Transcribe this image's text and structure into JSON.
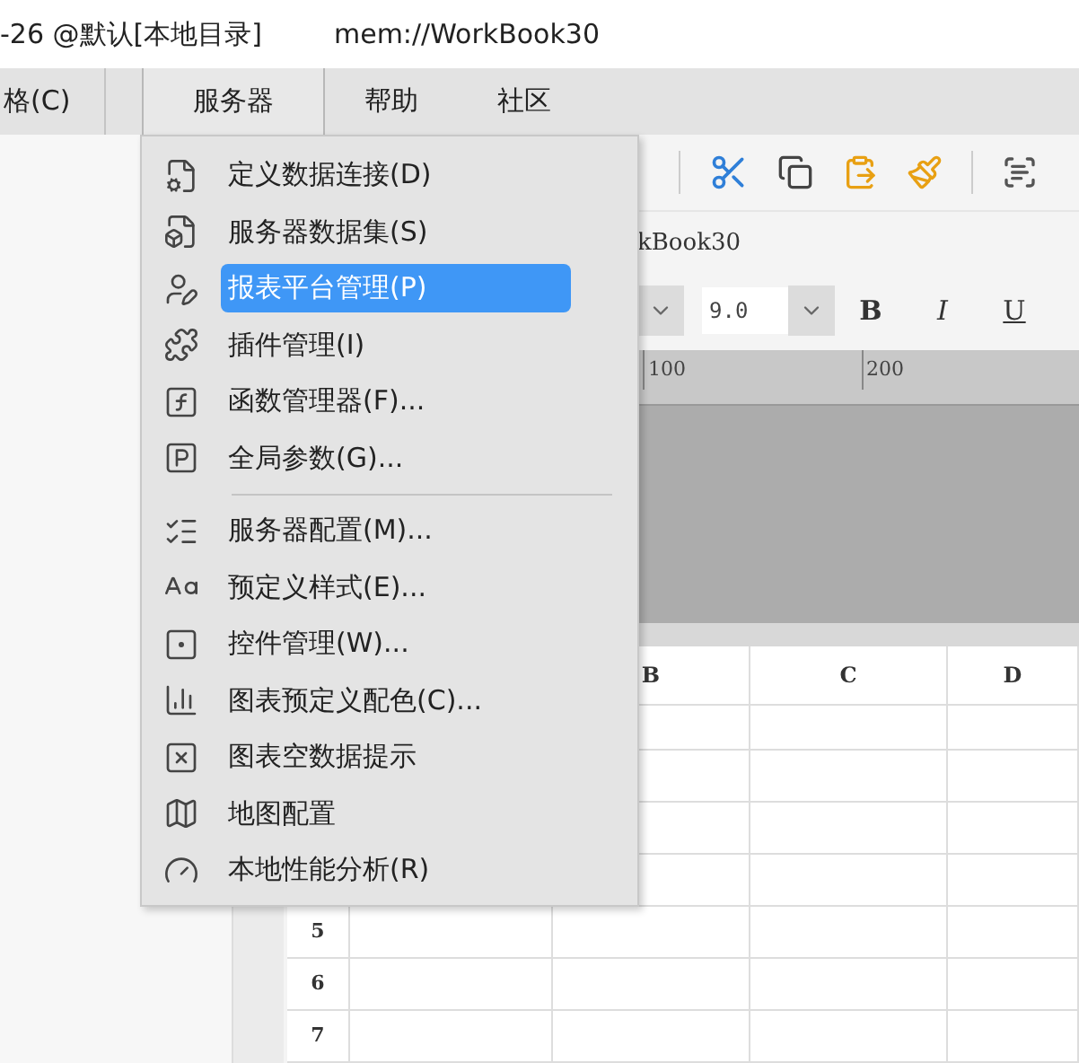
{
  "window": {
    "title": "-26 @默认[本地目录]",
    "path": "mem://WorkBook30"
  },
  "menubar": [
    {
      "label": "格(C)",
      "selected": false
    },
    {
      "label": "服务器",
      "selected": true
    },
    {
      "label": "帮助",
      "selected": false
    },
    {
      "label": "社区",
      "selected": false
    }
  ],
  "document": {
    "name": "kBook30"
  },
  "format": {
    "font_size": "9.0",
    "bold": "B",
    "italic": "I",
    "underline": "U"
  },
  "ruler": {
    "labels": [
      "100",
      "200"
    ]
  },
  "sheet": {
    "columns": [
      "B",
      "C",
      "D"
    ],
    "rows": [
      "5",
      "6",
      "7"
    ]
  },
  "server_menu": {
    "items": [
      {
        "kind": "item",
        "label": "定义数据连接(D)",
        "selected": false
      },
      {
        "kind": "item",
        "label": "服务器数据集(S)",
        "selected": false
      },
      {
        "kind": "item",
        "label": "报表平台管理(P)",
        "selected": true
      },
      {
        "kind": "item",
        "label": "插件管理(I)",
        "selected": false
      },
      {
        "kind": "item",
        "label": "函数管理器(F)...",
        "selected": false
      },
      {
        "kind": "item",
        "label": "全局参数(G)...",
        "selected": false
      },
      {
        "kind": "separator"
      },
      {
        "kind": "item",
        "label": "服务器配置(M)...",
        "selected": false
      },
      {
        "kind": "item",
        "label": "预定义样式(E)...",
        "selected": false
      },
      {
        "kind": "item",
        "label": "控件管理(W)...",
        "selected": false
      },
      {
        "kind": "item",
        "label": "图表预定义配色(C)...",
        "selected": false
      },
      {
        "kind": "item",
        "label": "图表空数据提示",
        "selected": false
      },
      {
        "kind": "item",
        "label": "地图配置",
        "selected": false
      },
      {
        "kind": "item",
        "label": "本地性能分析(R)",
        "selected": false
      }
    ]
  }
}
